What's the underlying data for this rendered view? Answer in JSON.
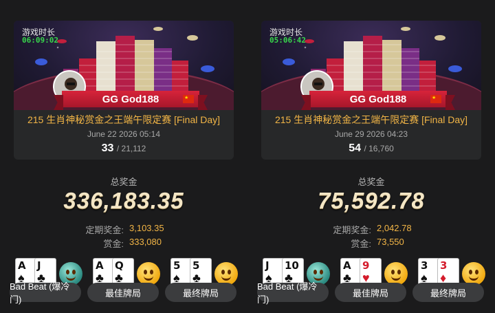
{
  "panels": [
    {
      "timer_label": "游戏时长",
      "timer_value": "06:09:02",
      "player_name": "GG God188",
      "flag": "China",
      "event_name": "215 生肖神秘赏金之王端午限定赛 [Final Day]",
      "event_date": "June 22 2026 05:14",
      "rank": "33",
      "total": "/ 21,112",
      "prize_label": "总奖金",
      "prize_amount": "336,183.35",
      "fixed_label": "定期奖金:",
      "fixed_value": "3,103.35",
      "bounty_label": "赏金:",
      "bounty_value": "333,080",
      "hands": [
        {
          "cards": [
            {
              "rank": "A",
              "suit": "♠",
              "color": "black"
            },
            {
              "rank": "J",
              "suit": "♣",
              "color": "black"
            }
          ],
          "emoji": "cold-face-icon",
          "label": "Bad Beat (爆冷门)"
        },
        {
          "cards": [
            {
              "rank": "A",
              "suit": "♣",
              "color": "black"
            },
            {
              "rank": "Q",
              "suit": "♣",
              "color": "black"
            }
          ],
          "emoji": "happy-face-icon",
          "label": "最佳牌局"
        },
        {
          "cards": [
            {
              "rank": "5",
              "suit": "♠",
              "color": "black"
            },
            {
              "rank": "5",
              "suit": "♣",
              "color": "black"
            }
          ],
          "emoji": "happy-face-icon",
          "label": "最终牌局"
        }
      ]
    },
    {
      "timer_label": "游戏时长",
      "timer_value": "05:06:42",
      "player_name": "GG God188",
      "flag": "China",
      "event_name": "215 生肖神秘赏金之王端午限定赛 [Final Day]",
      "event_date": "June 29 2026 04:23",
      "rank": "54",
      "total": "/ 16,760",
      "prize_label": "总奖金",
      "prize_amount": "75,592.78",
      "fixed_label": "定期奖金:",
      "fixed_value": "2,042.78",
      "bounty_label": "赏金:",
      "bounty_value": "73,550",
      "hands": [
        {
          "cards": [
            {
              "rank": "J",
              "suit": "♠",
              "color": "black"
            },
            {
              "rank": "10",
              "suit": "♣",
              "color": "black"
            }
          ],
          "emoji": "cold-face-icon",
          "label": "Bad Beat (爆冷门)"
        },
        {
          "cards": [
            {
              "rank": "A",
              "suit": "♣",
              "color": "black"
            },
            {
              "rank": "9",
              "suit": "♥",
              "color": "red"
            }
          ],
          "emoji": "happy-face-icon",
          "label": "最佳牌局"
        },
        {
          "cards": [
            {
              "rank": "3",
              "suit": "♠",
              "color": "black"
            },
            {
              "rank": "3",
              "suit": "♦",
              "color": "red"
            }
          ],
          "emoji": "happy-face-icon",
          "label": "最终牌局"
        }
      ]
    }
  ],
  "colors": {
    "background": "#1b1b1c",
    "card": "#272829",
    "accent_gold": "#f2b546",
    "timer_green": "#38d64c",
    "ribbon_red": "#d7233a"
  }
}
